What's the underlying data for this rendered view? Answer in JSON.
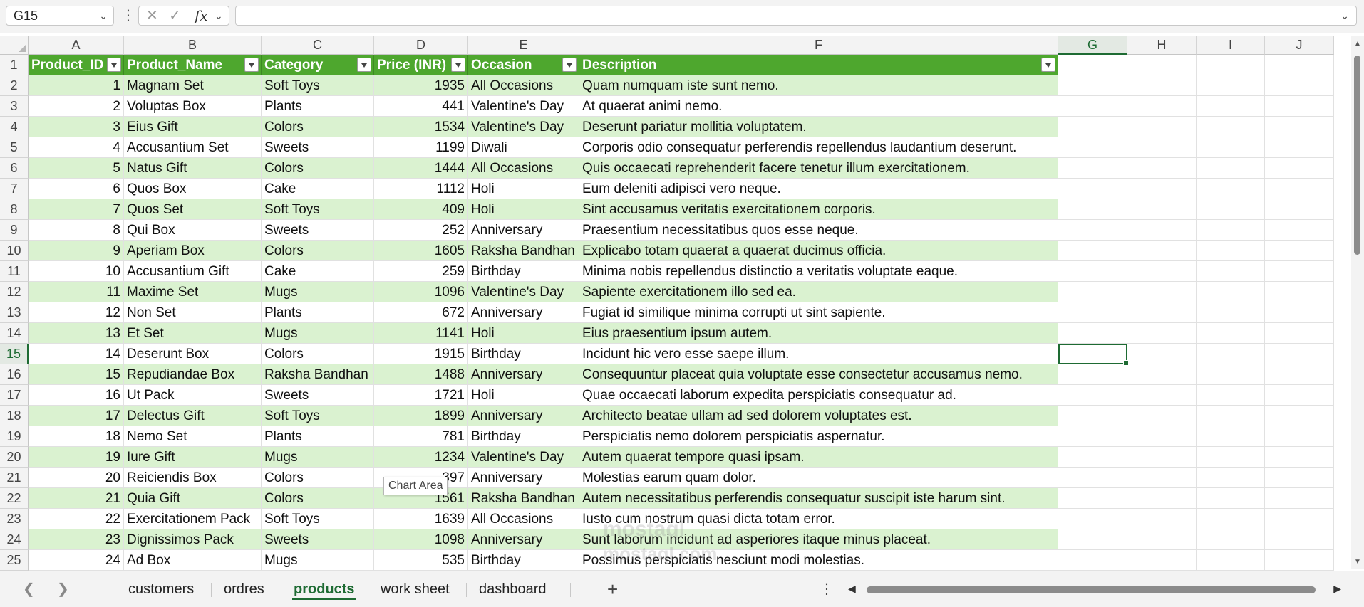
{
  "namebox": "G15",
  "columns": [
    "A",
    "B",
    "C",
    "D",
    "E",
    "F",
    "G",
    "H",
    "I",
    "J"
  ],
  "selected_column": "G",
  "selected_row": 15,
  "headers": [
    "Product_ID",
    "Product_Name",
    "Category",
    "Price (INR)",
    "Occasion",
    "Description"
  ],
  "rows": [
    [
      "1",
      "Magnam Set",
      "Soft Toys",
      "1935",
      "All Occasions",
      "Quam numquam iste sunt nemo."
    ],
    [
      "2",
      "Voluptas Box",
      "Plants",
      "441",
      "Valentine's Day",
      "At quaerat animi nemo."
    ],
    [
      "3",
      "Eius Gift",
      "Colors",
      "1534",
      "Valentine's Day",
      "Deserunt pariatur mollitia voluptatem."
    ],
    [
      "4",
      "Accusantium Set",
      "Sweets",
      "1199",
      "Diwali",
      "Corporis odio consequatur perferendis repellendus laudantium deserunt."
    ],
    [
      "5",
      "Natus Gift",
      "Colors",
      "1444",
      "All Occasions",
      "Quis occaecati reprehenderit facere tenetur illum exercitationem."
    ],
    [
      "6",
      "Quos Box",
      "Cake",
      "1112",
      "Holi",
      "Eum deleniti adipisci vero neque."
    ],
    [
      "7",
      "Quos Set",
      "Soft Toys",
      "409",
      "Holi",
      "Sint accusamus veritatis exercitationem corporis."
    ],
    [
      "8",
      "Qui Box",
      "Sweets",
      "252",
      "Anniversary",
      "Praesentium necessitatibus quos esse neque."
    ],
    [
      "9",
      "Aperiam Box",
      "Colors",
      "1605",
      "Raksha Bandhan",
      "Explicabo totam quaerat a quaerat ducimus officia."
    ],
    [
      "10",
      "Accusantium Gift",
      "Cake",
      "259",
      "Birthday",
      "Minima nobis repellendus distinctio a veritatis voluptate eaque."
    ],
    [
      "11",
      "Maxime Set",
      "Mugs",
      "1096",
      "Valentine's Day",
      "Sapiente exercitationem illo sed ea."
    ],
    [
      "12",
      "Non Set",
      "Plants",
      "672",
      "Anniversary",
      "Fugiat id similique minima corrupti ut sint sapiente."
    ],
    [
      "13",
      "Et Set",
      "Mugs",
      "1141",
      "Holi",
      "Eius praesentium ipsum autem."
    ],
    [
      "14",
      "Deserunt Box",
      "Colors",
      "1915",
      "Birthday",
      "Incidunt hic vero esse saepe illum."
    ],
    [
      "15",
      "Repudiandae Box",
      "Raksha Bandhan",
      "1488",
      "Anniversary",
      "Consequuntur placeat quia voluptate esse consectetur accusamus nemo."
    ],
    [
      "16",
      "Ut Pack",
      "Sweets",
      "1721",
      "Holi",
      "Quae occaecati laborum expedita perspiciatis consequatur ad."
    ],
    [
      "17",
      "Delectus Gift",
      "Soft Toys",
      "1899",
      "Anniversary",
      "Architecto beatae ullam ad sed dolorem voluptates est."
    ],
    [
      "18",
      "Nemo Set",
      "Plants",
      "781",
      "Birthday",
      "Perspiciatis nemo dolorem perspiciatis aspernatur."
    ],
    [
      "19",
      "Iure Gift",
      "Mugs",
      "1234",
      "Valentine's Day",
      "Autem quaerat tempore quasi ipsam."
    ],
    [
      "20",
      "Reiciendis Box",
      "Colors",
      "397",
      "Anniversary",
      "Molestias earum quam dolor."
    ],
    [
      "21",
      "Quia Gift",
      "Colors",
      "1561",
      "Raksha Bandhan",
      "Autem necessitatibus perferendis consequatur suscipit iste harum sint."
    ],
    [
      "22",
      "Exercitationem Pack",
      "Soft Toys",
      "1639",
      "All Occasions",
      "Iusto cum nostrum quasi dicta totam error."
    ],
    [
      "23",
      "Dignissimos Pack",
      "Sweets",
      "1098",
      "Anniversary",
      "Sunt laborum incidunt ad asperiores itaque minus placeat."
    ],
    [
      "24",
      "Ad Box",
      "Mugs",
      "535",
      "Birthday",
      "Possimus perspiciatis nesciunt modi molestias."
    ]
  ],
  "tooltip": "Chart Area",
  "sheet_tabs": [
    "customers",
    "ordres",
    "products",
    "work sheet",
    "dashboard"
  ],
  "active_tab": "products",
  "watermark": {
    "line1": "mostaql",
    "line2": "mostaql.com"
  },
  "colors": {
    "header_green": "#4ea72e",
    "band_green": "#daf2d0",
    "accent": "#1e6b33"
  }
}
